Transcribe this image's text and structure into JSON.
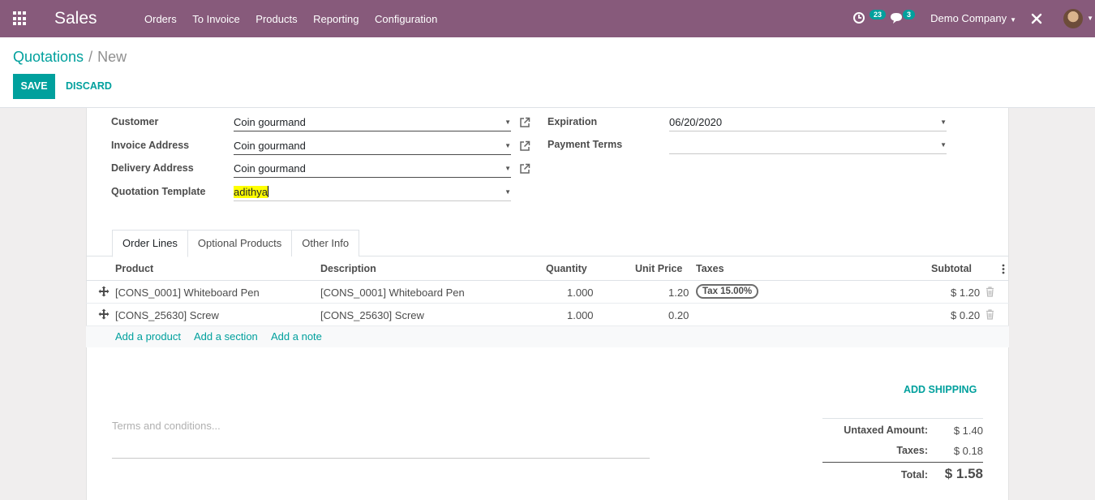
{
  "navbar": {
    "brand": "Sales",
    "menu": [
      "Orders",
      "To Invoice",
      "Products",
      "Reporting",
      "Configuration"
    ],
    "activity_count": "23",
    "message_count": "3",
    "company": "Demo Company"
  },
  "breadcrumb": {
    "parent": "Quotations",
    "separator": "/",
    "current": "New"
  },
  "actions": {
    "save": "SAVE",
    "discard": "DISCARD"
  },
  "form": {
    "customer_label": "Customer",
    "customer_value": "Coin gourmand",
    "invoice_label": "Invoice Address",
    "invoice_value": "Coin gourmand",
    "delivery_label": "Delivery Address",
    "delivery_value": "Coin gourmand",
    "template_label": "Quotation Template",
    "template_value": "adithya",
    "expiration_label": "Expiration",
    "expiration_value": "06/20/2020",
    "payment_terms_label": "Payment Terms",
    "payment_terms_value": ""
  },
  "tabs": [
    "Order Lines",
    "Optional Products",
    "Other Info"
  ],
  "table": {
    "headers": {
      "product": "Product",
      "description": "Description",
      "quantity": "Quantity",
      "unit_price": "Unit Price",
      "taxes": "Taxes",
      "subtotal": "Subtotal"
    },
    "rows": [
      {
        "product": "[CONS_0001] Whiteboard Pen",
        "description": "[CONS_0001] Whiteboard Pen",
        "quantity": "1.000",
        "unit_price": "1.20",
        "tax": "Tax 15.00%",
        "subtotal": "$ 1.20"
      },
      {
        "product": "[CONS_25630] Screw",
        "description": "[CONS_25630] Screw",
        "quantity": "1.000",
        "unit_price": "0.20",
        "tax": "",
        "subtotal": "$ 0.20"
      }
    ],
    "add_product": "Add a product",
    "add_section": "Add a section",
    "add_note": "Add a note"
  },
  "add_shipping": "ADD SHIPPING",
  "terms_placeholder": "Terms and conditions...",
  "totals": {
    "untaxed_label": "Untaxed Amount:",
    "untaxed_value": "$ 1.40",
    "taxes_label": "Taxes:",
    "taxes_value": "$ 0.18",
    "total_label": "Total:",
    "total_value": "$ 1.58"
  }
}
